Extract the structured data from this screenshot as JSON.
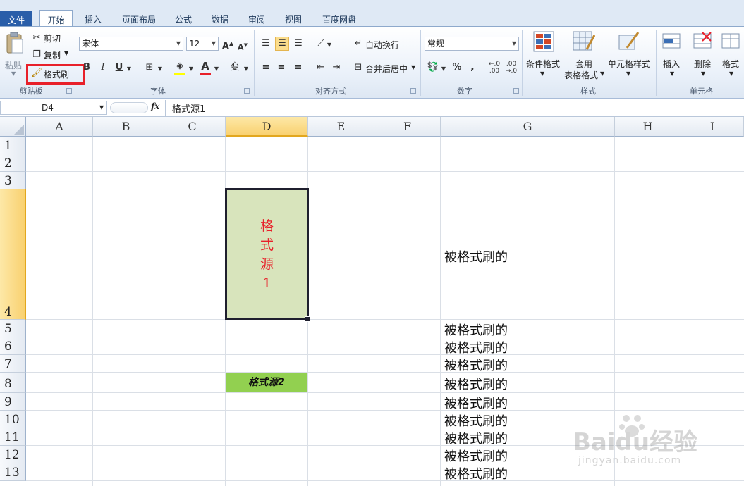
{
  "tabs": {
    "file": "文件",
    "home": "开始",
    "items": [
      {
        "label": "插入"
      },
      {
        "label": "页面布局"
      },
      {
        "label": "公式"
      },
      {
        "label": "数据"
      },
      {
        "label": "审阅"
      },
      {
        "label": "视图"
      },
      {
        "label": "百度网盘"
      }
    ]
  },
  "clipboard": {
    "paste": "粘贴",
    "cut": "剪切",
    "copy": "复制",
    "format_painter": "格式刷",
    "group": "剪贴板",
    "highlight_color": "#e8202a"
  },
  "font": {
    "name": "宋体",
    "size": "12",
    "bold": "B",
    "italic": "I",
    "underline": "U",
    "group": "字体"
  },
  "alignment": {
    "wrap": "自动换行",
    "merge": "合并后居中",
    "group": "对齐方式"
  },
  "number": {
    "format": "常规",
    "percent": "%",
    "comma": ",",
    "inc_decimal": "←.0 .00",
    "dec_decimal": ".00 →.0",
    "group": "数字"
  },
  "styles": {
    "conditional": "条件格式",
    "table_format_1": "套用",
    "table_format_2": "表格格式",
    "cell_styles": "单元格样式",
    "group": "样式"
  },
  "cells": {
    "insert": "插入",
    "delete": "删除",
    "format": "格式",
    "group": "单元格"
  },
  "formula_bar": {
    "name_box": "D4",
    "fx": "fx",
    "value": "格式源1"
  },
  "columns": [
    "A",
    "B",
    "C",
    "D",
    "E",
    "F",
    "G",
    "H",
    "I"
  ],
  "rows": [
    "1",
    "2",
    "3",
    "4",
    "5",
    "6",
    "7",
    "8",
    "9",
    "10",
    "11",
    "12",
    "13"
  ],
  "cells_content": {
    "d4_chars": [
      "格",
      "式",
      "源",
      "1"
    ],
    "d8": "格式源2",
    "g_rows": [
      {
        "row": "4",
        "text": "被格式刷的"
      },
      {
        "row": "5",
        "text": "被格式刷的"
      },
      {
        "row": "6",
        "text": "被格式刷的"
      },
      {
        "row": "7",
        "text": "被格式刷的"
      },
      {
        "row": "8",
        "text": "被格式刷的"
      },
      {
        "row": "9",
        "text": "被格式刷的"
      },
      {
        "row": "10",
        "text": "被格式刷的"
      },
      {
        "row": "11",
        "text": "被格式刷的"
      },
      {
        "row": "12",
        "text": "被格式刷的"
      },
      {
        "row": "13",
        "text": "被格式刷的"
      }
    ]
  },
  "colors": {
    "d4_fill": "#d8e4bc",
    "d4_text": "#e8202a",
    "d8_fill": "#92d050",
    "selection_header": "#f9d170"
  },
  "watermark": {
    "brand": "Baidu经验",
    "url": "jingyan.baidu.com"
  }
}
